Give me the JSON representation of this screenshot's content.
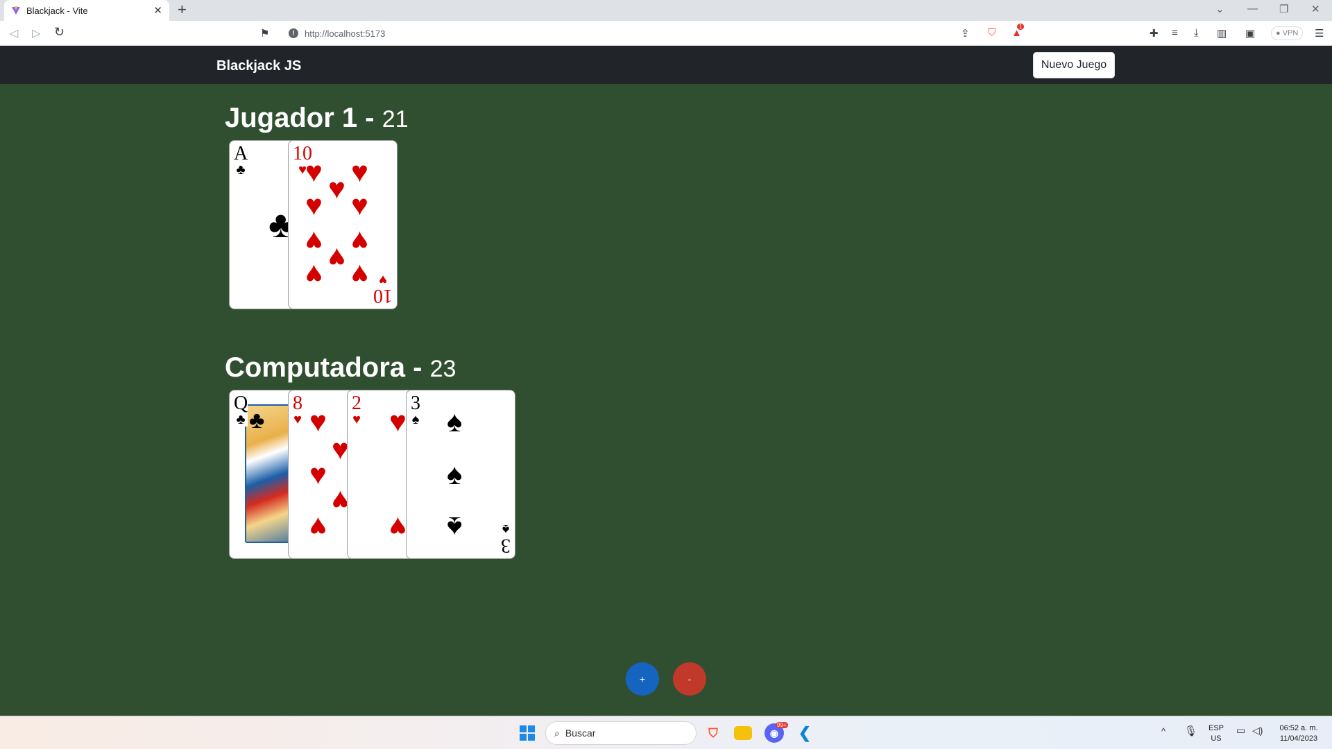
{
  "browser": {
    "tab_title": "Blackjack - Vite",
    "tab_close": "✕",
    "new_tab": "+",
    "url": "http://localhost:5173",
    "vpn_label": "● VPN",
    "shield_badge": "1"
  },
  "app": {
    "brand": "Blackjack JS",
    "new_game_button": "Nuevo Juego",
    "hit_button": "+",
    "stand_button": "-",
    "colors": {
      "table": "#2f4f30",
      "navbar": "#212529",
      "hit": "#1565c0",
      "stand": "#c0392b"
    }
  },
  "players": [
    {
      "name": "Jugador 1 -",
      "score": "21",
      "cards": [
        {
          "rank": "A",
          "suit": "♣",
          "color": "black"
        },
        {
          "rank": "10",
          "suit": "♥",
          "color": "red"
        }
      ]
    },
    {
      "name": "Computadora -",
      "score": "23",
      "cards": [
        {
          "rank": "Q",
          "suit": "♣",
          "color": "black"
        },
        {
          "rank": "8",
          "suit": "♥",
          "color": "red"
        },
        {
          "rank": "2",
          "suit": "♥",
          "color": "red"
        },
        {
          "rank": "3",
          "suit": "♠",
          "color": "black"
        }
      ]
    }
  ],
  "taskbar": {
    "search_placeholder": "Buscar",
    "language": "ESP",
    "region": "US",
    "time": "06:52 a. m.",
    "date": "11/04/2023",
    "chat_badge": "99+"
  }
}
